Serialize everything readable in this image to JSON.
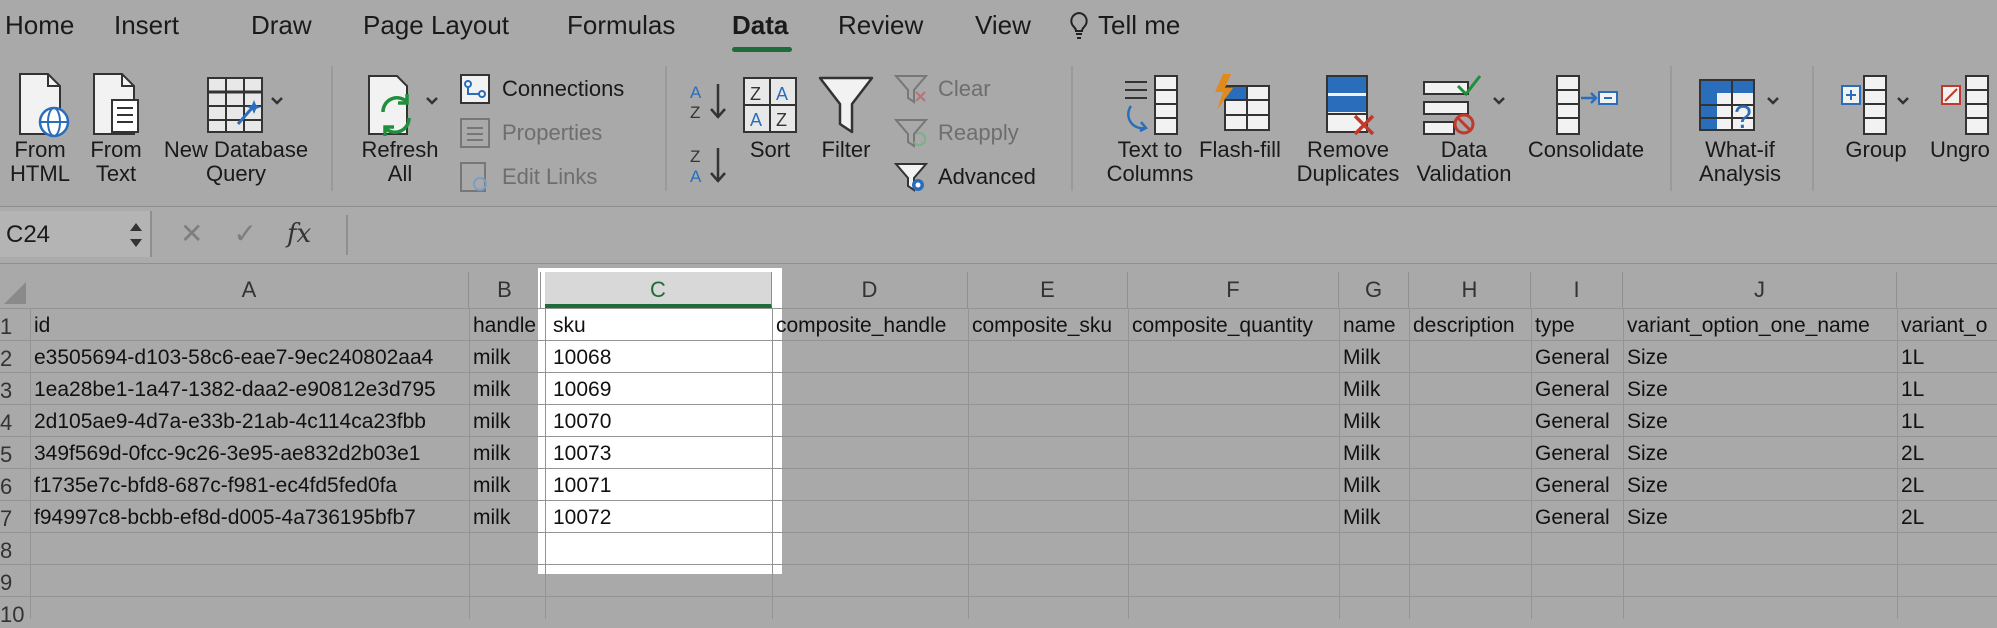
{
  "menu": {
    "tabs": [
      "Home",
      "Insert",
      "Draw",
      "Page Layout",
      "Formulas",
      "Data",
      "Review",
      "View"
    ],
    "active_tab": "Data",
    "tell_me": "Tell me"
  },
  "ribbon": {
    "from_html": [
      "From",
      "HTML"
    ],
    "from_text": [
      "From",
      "Text"
    ],
    "new_db_query": [
      "New Database",
      "Query"
    ],
    "refresh_all": [
      "Refresh",
      "All"
    ],
    "connections": "Connections",
    "properties": "Properties",
    "edit_links": "Edit Links",
    "sort": "Sort",
    "filter": "Filter",
    "clear": "Clear",
    "reapply": "Reapply",
    "advanced": "Advanced",
    "text_to_columns": [
      "Text to",
      "Columns"
    ],
    "flash_fill": "Flash-fill",
    "remove_duplicates": [
      "Remove",
      "Duplicates"
    ],
    "data_validation": [
      "Data",
      "Validation"
    ],
    "consolidate": "Consolidate",
    "what_if": [
      "What-if",
      "Analysis"
    ],
    "group": "Group",
    "ungroup": "Ungro"
  },
  "formula_bar": {
    "name_box": "C24",
    "fx": "fx",
    "formula": ""
  },
  "sheet": {
    "columns": [
      "A",
      "B",
      "C",
      "D",
      "E",
      "F",
      "G",
      "H",
      "I",
      "J"
    ],
    "selected_column": "C",
    "row_numbers": [
      "1",
      "2",
      "3",
      "4",
      "5",
      "6",
      "7",
      "8",
      "9",
      "10"
    ],
    "header_row": [
      "id",
      "handle",
      "sku",
      "composite_handle",
      "composite_sku",
      "composite_quantity",
      "name",
      "description",
      "type",
      "variant_option_one_name",
      "variant_o"
    ],
    "rows": [
      [
        "e3505694-d103-58c6-eae7-9ec240802aa4",
        "milk",
        "10068",
        "",
        "",
        "",
        "Milk",
        "",
        "General",
        "Size",
        "1L"
      ],
      [
        "1ea28be1-1a47-1382-daa2-e90812e3d795",
        "milk",
        "10069",
        "",
        "",
        "",
        "Milk",
        "",
        "General",
        "Size",
        "1L"
      ],
      [
        "2d105ae9-4d7a-e33b-21ab-4c114ca23fbb",
        "milk",
        "10070",
        "",
        "",
        "",
        "Milk",
        "",
        "General",
        "Size",
        "1L"
      ],
      [
        "349f569d-0fcc-9c26-3e95-ae832d2b03e1",
        "milk",
        "10073",
        "",
        "",
        "",
        "Milk",
        "",
        "General",
        "Size",
        "2L"
      ],
      [
        "f1735e7c-bfd8-687c-f981-ec4fd5fed0fa",
        "milk",
        "10071",
        "",
        "",
        "",
        "Milk",
        "",
        "General",
        "Size",
        "2L"
      ],
      [
        "f94997c8-bcbb-ef8d-d005-4a736195bfb7",
        "milk",
        "10072",
        "",
        "",
        "",
        "Milk",
        "",
        "General",
        "Size",
        "2L"
      ]
    ]
  },
  "colors": {
    "accent": "#1e6b3c",
    "sheet_bg": "#a9a9a9",
    "selected_column_bg": "#ffffff",
    "icon_blue": "#2a6ebb"
  }
}
